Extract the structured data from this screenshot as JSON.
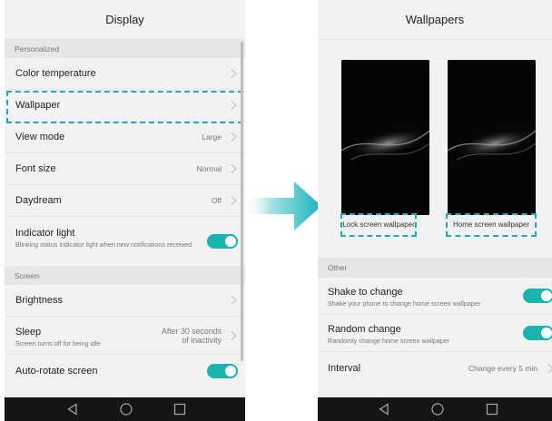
{
  "display_screen": {
    "title": "Display",
    "section_personalized": "Personalized",
    "items": {
      "color_temperature": {
        "label": "Color temperature"
      },
      "wallpaper": {
        "label": "Wallpaper"
      },
      "view_mode": {
        "label": "View mode",
        "value": "Large"
      },
      "font_size": {
        "label": "Font size",
        "value": "Normal"
      },
      "daydream": {
        "label": "Daydream",
        "value": "Off"
      },
      "indicator_light": {
        "label": "Indicator light",
        "description": "Blinking status indicator light when new notifications received",
        "enabled": true
      }
    },
    "section_screen": "Screen",
    "screen_items": {
      "brightness": {
        "label": "Brightness"
      },
      "sleep": {
        "label": "Sleep",
        "description": "Screen turns off for being idle",
        "value_line1": "After 30 seconds",
        "value_line2": "of inactivity"
      },
      "auto_rotate": {
        "label": "Auto-rotate screen",
        "enabled": true
      }
    }
  },
  "wallpapers_screen": {
    "title": "Wallpapers",
    "lock_screen_label": "Lock screen wallpaper",
    "home_screen_label": "Home screen wallpaper",
    "section_other": "Other",
    "shake_to_change": {
      "label": "Shake to change",
      "description": "Shake your phone to change home screen wallpaper",
      "enabled": true
    },
    "random_change": {
      "label": "Random change",
      "description": "Randomly change home screen wallpaper",
      "enabled": true
    },
    "interval": {
      "label": "Interval",
      "value": "Change every 5 min"
    }
  },
  "colors": {
    "accent": "#1ab3b0",
    "highlight_dash": "#22aab0",
    "nav_bar": "#151515"
  },
  "icons": {
    "nav_back": "back-triangle-icon",
    "nav_home": "home-circle-icon",
    "nav_recents": "recents-square-icon",
    "chevron": "chevron-right-icon",
    "transition_arrow": "arrow-right-icon"
  }
}
